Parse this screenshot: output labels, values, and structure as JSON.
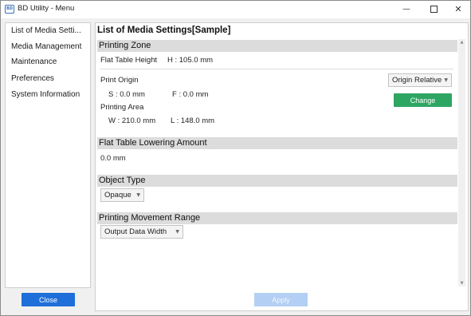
{
  "window": {
    "icon_label": "BD",
    "title": "BD Utility - Menu",
    "minimize_glyph": "—",
    "close_glyph": "✕"
  },
  "sidebar": {
    "items": [
      {
        "label": "List of Media Setti..."
      },
      {
        "label": "Media Management"
      },
      {
        "label": "Maintenance"
      },
      {
        "label": "Preferences"
      },
      {
        "label": "System Information"
      }
    ],
    "close_label": "Close"
  },
  "main": {
    "title": "List of Media Settings[Sample]",
    "printing_zone": {
      "heading": "Printing Zone",
      "flat_table_height_label": "Flat Table Height",
      "flat_table_height_value": "H : 105.0 mm",
      "print_origin_label": "Print Origin",
      "origin_s": "S :     0.0 mm",
      "origin_f": "F :     0.0 mm",
      "origin_mode_selected": "Origin Relative",
      "change_label": "Change",
      "printing_area_label": "Printing Area",
      "area_w": "W : 210.0 mm",
      "area_l": "L : 148.0 mm"
    },
    "lowering": {
      "heading": "Flat Table Lowering Amount",
      "value": "0.0 mm"
    },
    "object_type": {
      "heading": "Object Type",
      "selected": "Opaque"
    },
    "movement_range": {
      "heading": "Printing Movement Range",
      "selected": "Output Data Width"
    },
    "apply_label": "Apply"
  },
  "icons": {
    "dropdown_chevron": "▼",
    "scroll_up": "▲",
    "scroll_down": "▼"
  }
}
